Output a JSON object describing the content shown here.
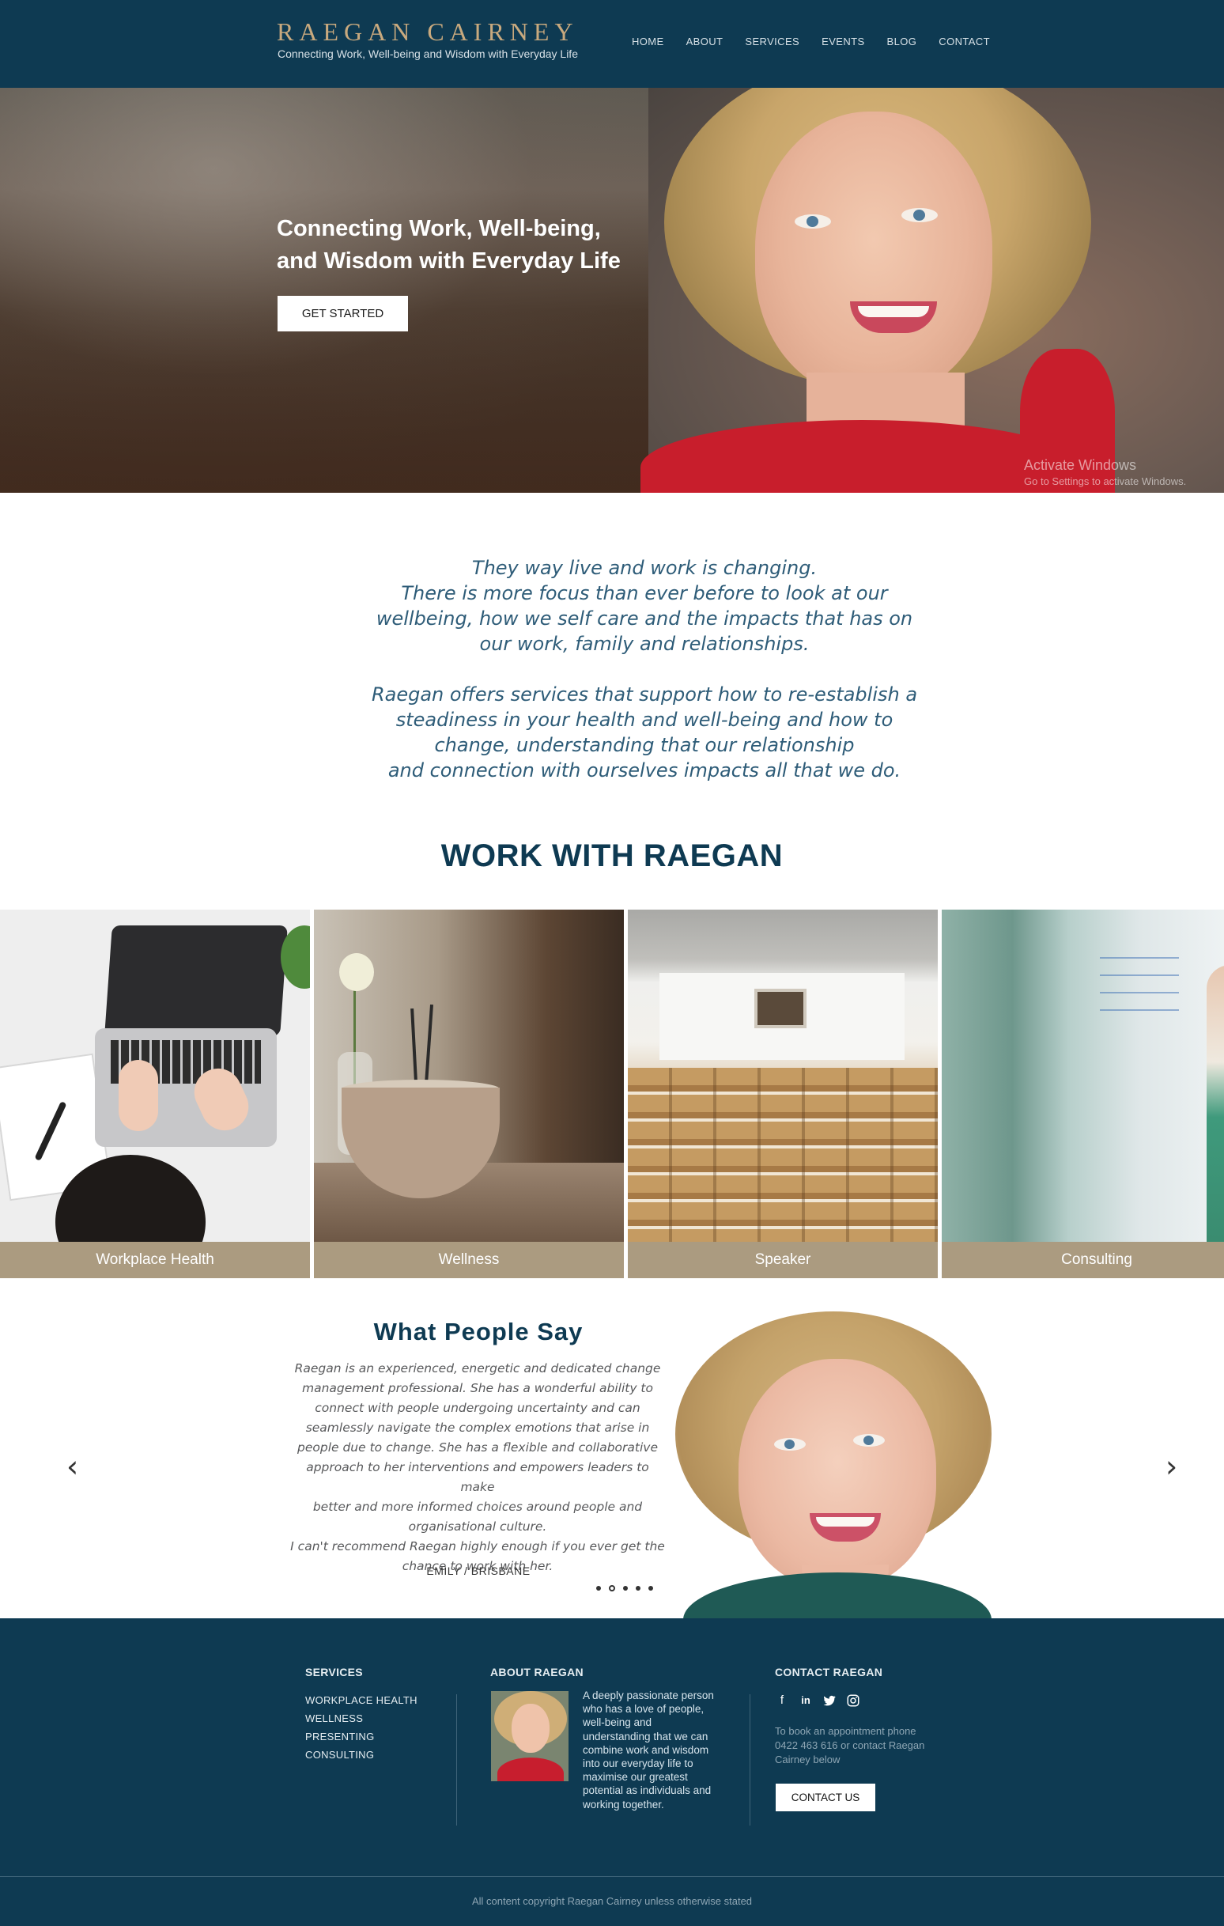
{
  "header": {
    "logo": "RAEGAN CAIRNEY",
    "tagline": "Connecting Work, Well-being and Wisdom with Everyday Life",
    "nav": [
      "HOME",
      "ABOUT",
      "SERVICES",
      "EVENTS",
      "BLOG",
      "CONTACT"
    ]
  },
  "hero": {
    "title": "Connecting Work, Well-being, and Wisdom with Everyday Life",
    "button": "GET STARTED",
    "watermark_title": "Activate Windows",
    "watermark_sub": "Go to Settings to activate Windows."
  },
  "intro": {
    "p1_lines": [
      "They way live and work is changing.",
      "There is more focus than ever before to look at our",
      "wellbeing, how we self care and the impacts that has on",
      "our work, family and relationships."
    ],
    "p2_lines": [
      "Raegan offers services that support how to re-establish a",
      "steadiness in your health and well-being and how to",
      "change, understanding that our relationship",
      "and connection with ourselves impacts all that we do."
    ]
  },
  "work": {
    "title": "WORK WITH RAEGAN",
    "tiles": [
      "Workplace Health",
      "Wellness",
      "Speaker",
      "Consulting"
    ]
  },
  "testimonial": {
    "title": "What People Say",
    "quote_lines": [
      "Raegan is an experienced, energetic and dedicated change",
      "management professional. She has a wonderful ability to",
      "connect with people undergoing uncertainty and can",
      "seamlessly navigate the complex emotions that arise in",
      "people due to change. She has a flexible and collaborative",
      "approach to her interventions and empowers leaders to make",
      "better and more informed choices around people and",
      "organisational culture.",
      "I can't recommend Raegan highly enough if you ever get the",
      "chance to work with her."
    ],
    "author": "EMILY / BRISBANE",
    "slide_count": 5,
    "active_slide": 2,
    "prev_arrow": "‹",
    "next_arrow": "›"
  },
  "footer": {
    "services_title": "SERVICES",
    "services": [
      "WORKPLACE HEALTH",
      "WELLNESS",
      "PRESENTING",
      "CONSULTING"
    ],
    "about_title": "ABOUT RAEGAN",
    "about_lines": [
      "A deeply passionate person",
      "who has a love of people,",
      "well-being and",
      "understanding that we can",
      "combine work and wisdom",
      "into our everyday life to",
      "maximise our greatest",
      "potential as individuals and",
      "working together."
    ],
    "contact_title": "CONTACT RAEGAN",
    "social_icons": [
      "facebook-icon",
      "linkedin-icon",
      "twitter-icon",
      "instagram-icon"
    ],
    "contact_lines": [
      "To book an appointment phone",
      "0422 463 616 or contact Raegan",
      "Cairney below"
    ],
    "contact_button": "CONTACT US",
    "copyright": "All content copyright Raegan Cairney unless otherwise stated"
  }
}
